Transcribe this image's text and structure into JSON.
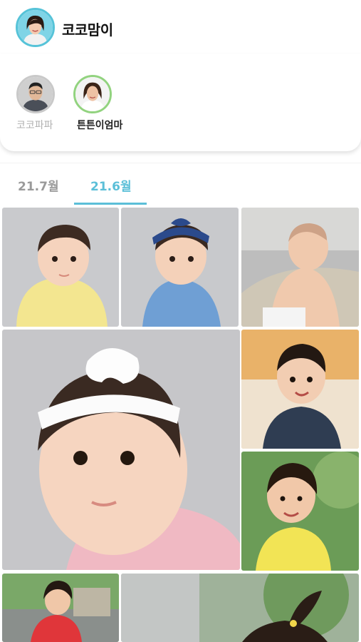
{
  "header": {
    "title": "코코맘이",
    "avatar_icon": "profile-avatar-icon"
  },
  "members": [
    {
      "label": "코코파파",
      "active": false,
      "ring_color": "#c9c9c9"
    },
    {
      "label": "튼튼이엄마",
      "active": true,
      "ring_color": "#92d37f"
    }
  ],
  "tabs": [
    {
      "label": "21.7월",
      "selected": false
    },
    {
      "label": "21.6월",
      "selected": true
    }
  ],
  "colors": {
    "accent": "#5bbfd8",
    "avatar_ring": "#56c3d8"
  },
  "photos": [
    {
      "name": "baby-yellow-top"
    },
    {
      "name": "baby-blue-headband"
    },
    {
      "name": "baby-chair"
    },
    {
      "name": "baby-white-bow-large"
    },
    {
      "name": "baby-overalls-sofa"
    },
    {
      "name": "baby-yellow-shirt-outdoor"
    },
    {
      "name": "toddler-red-outdoor"
    },
    {
      "name": "child-outdoor-ponytail"
    }
  ]
}
